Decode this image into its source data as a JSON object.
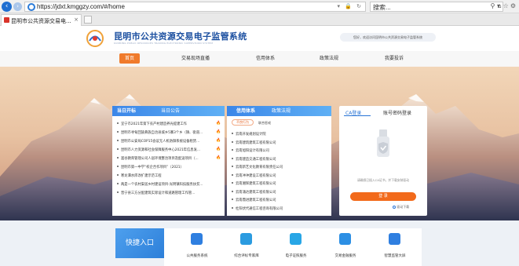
{
  "browser": {
    "url": "https://jdxt.kmggzy.com/#/home",
    "search_placeholder": "搜索...",
    "tab_title": "昆明市公共资源交易电...",
    "tab_close": "×"
  },
  "header": {
    "site_title": "昆明市公共资源交易电子监管系统",
    "site_subtitle": "KUNMING PUBLIC RESOURCES TRADING ELECTRONIC SUPERVISION SYSTEM",
    "welcome": "您好，欢迎访问昆明市公共资源交易电子监管系统"
  },
  "nav": {
    "items": [
      "首页",
      "交易现场直播",
      "信用体系",
      "政策法规",
      "我要投诉"
    ]
  },
  "left_panel": {
    "tabs": [
      "当日开标",
      "当日公告"
    ],
    "rows": [
      {
        "text": "宜宁市2021年第下农产村建造养光提建工作",
        "hot": true
      },
      {
        "text": "昆明市寻甸回族彝族自治县城乡5寨3个乡（镇、街道...",
        "hot": true
      },
      {
        "text": "昆明市公安局COP15会议无人机防御系统设备租赁...",
        "hot": true
      },
      {
        "text": "昆明市人力资源和社会保障服务中心2021年信息发...",
        "hot": true
      },
      {
        "text": "嵩谷教育管理公司人居环境整治项目及配送项目（...",
        "hot": true
      },
      {
        "text": "昆明市第一中学“校企合作项目”（2021）",
        "hot": false
      },
      {
        "text": "寒龙潭水库改扩建示范工程",
        "hot": false
      },
      {
        "text": "两是一个农村安居乡村建设项目-光明镇科技服务扶贫...",
        "hot": false
      },
      {
        "text": "晋宁县三方分配建筑实际设计和道路管理工作管...",
        "hot": false
      }
    ]
  },
  "mid_panel": {
    "tabs": [
      "信用体系",
      "政策法规"
    ],
    "subtabs": [
      "不良行为",
      "联合惩戒"
    ],
    "rows": [
      "云南开发规划设计院",
      "云南建筑建筑工程有限公司",
      "云南旭阳设计有限公司",
      "云南建造交通工程有限公司",
      "云南新艺文化教育有限责任公司",
      "云南冲冲建设工程有限公司",
      "云南湘辉建筑工程有限公司",
      "云南涌达建筑工程有限公司",
      "云南鼎进建筑工程有限公司",
      "杜阳伏代通信工程咨询有限公司"
    ]
  },
  "login_panel": {
    "tabs": [
      "CA登录",
      "账号密码登录"
    ],
    "hint": "请确保已插入CA证书，并下载安装驱动",
    "login_button": "登 录",
    "driver_link": "驱动下载"
  },
  "quick": {
    "title": "快捷入口",
    "items": [
      {
        "label": "公共服务系统",
        "color": "#2f7fe0"
      },
      {
        "label": "综合评标专家库",
        "color": "#2b9be0"
      },
      {
        "label": "电子证照服务",
        "color": "#28a6e6"
      },
      {
        "label": "交易金融服务",
        "color": "#2c8fe4"
      },
      {
        "label": "智慧监管大屏",
        "color": "#2f7fe0"
      }
    ]
  }
}
